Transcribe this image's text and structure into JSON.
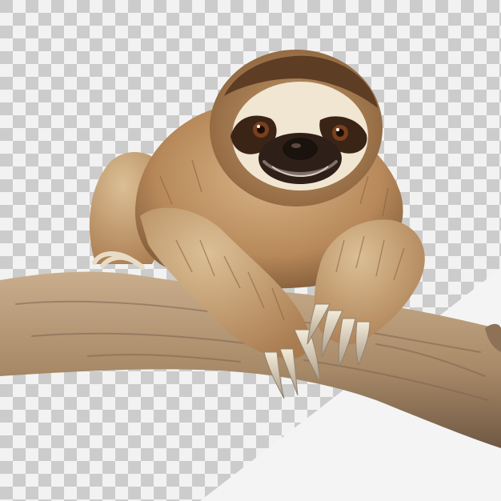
{
  "image": {
    "subject": "sloth",
    "background": "transparency-checkerboard",
    "colors": {
      "checker_light": "#f2f2f2",
      "checker_dark": "#cccccc",
      "fur_light": "#cfa978",
      "fur_mid": "#b8895a",
      "fur_dark": "#7a5233",
      "face_mask": "#f1e6d2",
      "eye_stripe": "#3a2416",
      "branch_light": "#c9ad8c",
      "branch_mid": "#a88a68",
      "branch_dark": "#6f5843",
      "claw": "#e8dcc6",
      "white_panel": "#f4f4f5"
    }
  }
}
